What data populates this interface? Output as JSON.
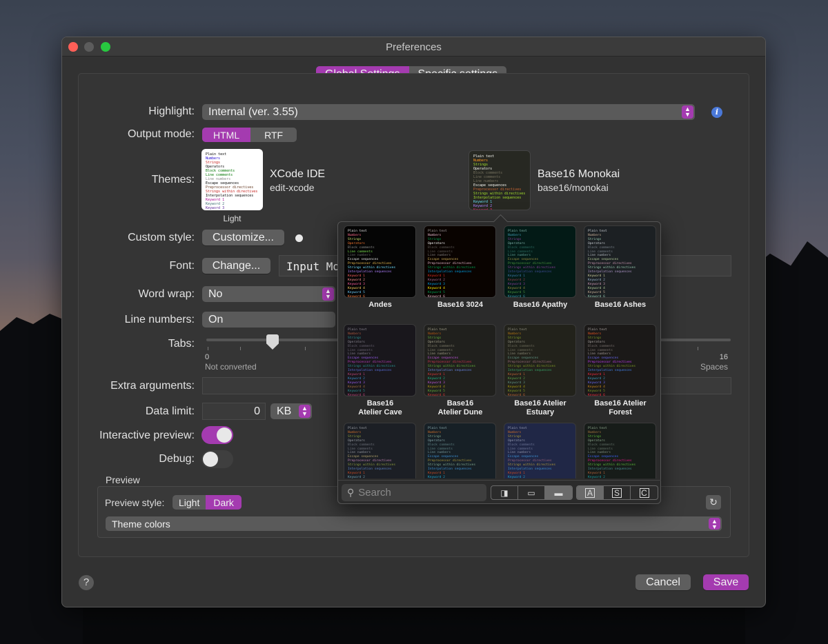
{
  "window": {
    "title": "Preferences"
  },
  "tabs": {
    "global": "Global Settings",
    "specific": "Specific settings"
  },
  "highlight": {
    "label": "Highlight:",
    "value": "Internal (ver. 3.55)",
    "info_icon": "info-icon"
  },
  "output_mode": {
    "label": "Output mode:",
    "options": [
      "HTML",
      "RTF"
    ],
    "selected": "HTML"
  },
  "themes": {
    "label": "Themes:",
    "light": {
      "name": "XCode IDE",
      "id": "edit-xcode",
      "caption": "Light"
    },
    "dark": {
      "name": "Base16 Monokai",
      "id": "base16/monokai"
    }
  },
  "custom_style": {
    "label": "Custom style:",
    "button": "Customize..."
  },
  "font": {
    "label": "Font:",
    "button": "Change...",
    "value": "Input Mo"
  },
  "word_wrap": {
    "label": "Word wrap:",
    "value": "No"
  },
  "line_numbers": {
    "label": "Line numbers:",
    "value": "On"
  },
  "tabs_setting": {
    "label": "Tabs:",
    "min": "0",
    "min_caption": "Not converted",
    "max": "16",
    "max_caption": "Spaces",
    "value": 2
  },
  "extra_args": {
    "label": "Extra arguments:"
  },
  "data_limit": {
    "label": "Data limit:",
    "value": "0",
    "unit": "KB"
  },
  "interactive_preview": {
    "label": "Interactive preview:",
    "on": true
  },
  "debug": {
    "label": "Debug:",
    "on": false
  },
  "preview": {
    "section": "Preview",
    "style_label": "Preview style:",
    "styles": [
      "Light",
      "Dark"
    ],
    "selected_style": "Dark",
    "colors_value": "Theme colors"
  },
  "theme_sample_lines": [
    "Plain text",
    "Numbers",
    "Strings",
    "Operators",
    "Block comments",
    "Line comments",
    "Line numbers",
    "Escape sequences",
    "Preprocessor directives",
    "Strings within directives",
    "Interpolation sequences",
    "Keyword 1",
    "Keyword 2",
    "Keyword 3",
    "Keyword 4",
    "Keyword 5",
    "Keyword 6"
  ],
  "theme_gallery": [
    {
      "name": "Andes",
      "bg": "#050505",
      "colors": [
        "#e6e6e6",
        "#ff6a8a",
        "#cfe870",
        "#ff7a30",
        "#8a8a8a",
        "#7ae050",
        "#666",
        "#e0e0e0",
        "#f0c050",
        "#70e0ff",
        "#b080ff",
        "#ff6060",
        "#ff9090",
        "#ff60a0",
        "#ffd060",
        "#70d0ff",
        "#ff8040"
      ]
    },
    {
      "name": "Base16 3024",
      "bg": "#090300",
      "colors": [
        "#a5a2a2",
        "#e8bbd0",
        "#01a252",
        "#ffffff",
        "#5c5855",
        "#5c5855",
        "#807d7c",
        "#cdab53",
        "#e8bbd0",
        "#01a252",
        "#01a0e4",
        "#db2d20",
        "#a16a94",
        "#01a0e4",
        "#fded02",
        "#01a252",
        "#e8bbd0"
      ]
    },
    {
      "name": "Base16 Apathy",
      "bg": "#031a16",
      "colors": [
        "#81b5ac",
        "#3e96ac",
        "#883e96",
        "#81b5ac",
        "#2b685e",
        "#2b685e",
        "#5f9c92",
        "#96883e",
        "#4c963e",
        "#883e96",
        "#3e4c96",
        "#3e79a9",
        "#963e4c",
        "#883e96",
        "#96883e",
        "#4c963e",
        "#3e96ac"
      ]
    },
    {
      "name": "Base16 Ashes",
      "bg": "#1c2023",
      "colors": [
        "#c7ccd1",
        "#c7ae95",
        "#95c7ae",
        "#c7ccd1",
        "#747c84",
        "#747c84",
        "#adb3ba",
        "#aec795",
        "#c795ae",
        "#95c7ae",
        "#ae95c7",
        "#c7c795",
        "#95aec7",
        "#c795ae",
        "#aec795",
        "#c7ae95",
        "#95c7ae"
      ]
    },
    {
      "name": "Base16\nAtelier Cave",
      "bg": "#19171c",
      "colors": [
        "#8b8792",
        "#aa573c",
        "#2a9292",
        "#8b8792",
        "#655f6d",
        "#655f6d",
        "#7e7887",
        "#955ae7",
        "#bf40bf",
        "#2a9292",
        "#576ddb",
        "#be4678",
        "#398bc6",
        "#955ae7",
        "#a06e3b",
        "#2a9292",
        "#be4678"
      ]
    },
    {
      "name": "Base16\nAtelier Dune",
      "bg": "#20201d",
      "colors": [
        "#a6a28c",
        "#b65611",
        "#60ac39",
        "#a6a28c",
        "#7d7a68",
        "#7d7a68",
        "#999580",
        "#b854d4",
        "#d43552",
        "#60ac39",
        "#6684e1",
        "#d73737",
        "#1fad83",
        "#b854d4",
        "#ae9513",
        "#60ac39",
        "#d73737"
      ]
    },
    {
      "name": "Base16 Atelier\nEstuary",
      "bg": "#22221b",
      "colors": [
        "#929181",
        "#ae7313",
        "#7d9726",
        "#929181",
        "#6c6b5a",
        "#6c6b5a",
        "#878573",
        "#5f9182",
        "#9d6c7c",
        "#7d9726",
        "#36a166",
        "#ba6236",
        "#5b9d48",
        "#5f9182",
        "#a5980d",
        "#7d9726",
        "#ba6236"
      ]
    },
    {
      "name": "Base16 Atelier\nForest",
      "bg": "#1b1918",
      "colors": [
        "#a8a19f",
        "#df5320",
        "#7b9726",
        "#a8a19f",
        "#766e6b",
        "#766e6b",
        "#9c9491",
        "#6666ea",
        "#c33ff3",
        "#7b9726",
        "#407ee7",
        "#f22c40",
        "#3d97b8",
        "#6666ea",
        "#c38418",
        "#7b9726",
        "#f22c40"
      ]
    },
    {
      "name": "",
      "bg": "#1c1f25",
      "colors": [
        "#9da1a8",
        "#c76b29",
        "#8a9a3c",
        "#9da1a8",
        "#6b6f78",
        "#6b6f78",
        "#8a8d95",
        "#b0a06a",
        "#c080b0",
        "#8a9a3c",
        "#5a80c0",
        "#c94922",
        "#70a0b0",
        "#9a70c0",
        "#c08b30",
        "#8a9a3c",
        "#c94922"
      ]
    },
    {
      "name": "",
      "bg": "#172026",
      "colors": [
        "#87a7ab",
        "#c76b29",
        "#7ea68e",
        "#87a7ab",
        "#5a7b7e",
        "#5a7b7e",
        "#6f9094",
        "#3d8fd1",
        "#ac9739",
        "#7ea68e",
        "#3d8fd1",
        "#c94922",
        "#22a2c9",
        "#6679cc",
        "#c08b30",
        "#7ea68e",
        "#c94922"
      ]
    },
    {
      "name": "",
      "bg": "#202746",
      "colors": [
        "#979db4",
        "#c76b29",
        "#ac9739",
        "#979db4",
        "#6b7394",
        "#6b7394",
        "#898ea4",
        "#3d8fd1",
        "#9c637a",
        "#ac9739",
        "#3d8fd1",
        "#c94922",
        "#22a2c9",
        "#6679cc",
        "#c08b30",
        "#ac9739",
        "#c94922"
      ]
    },
    {
      "name": "",
      "bg": "#171c19",
      "colors": [
        "#8ca68c",
        "#9f713c",
        "#5ab738",
        "#8ca68c",
        "#5f6d64",
        "#5f6d64",
        "#78877d",
        "#3d62f5",
        "#e6198a",
        "#5ab738",
        "#478c90",
        "#b16139",
        "#1c9aa0",
        "#55859b",
        "#a07e3b",
        "#5ab738",
        "#b16139"
      ]
    }
  ],
  "gallery_search": {
    "placeholder": "Search"
  },
  "footer": {
    "help": "?",
    "cancel": "Cancel",
    "save": "Save"
  },
  "colors": {
    "accent": "#a43bb0",
    "window_bg": "#323232",
    "control_bg": "#5a5a5a"
  }
}
